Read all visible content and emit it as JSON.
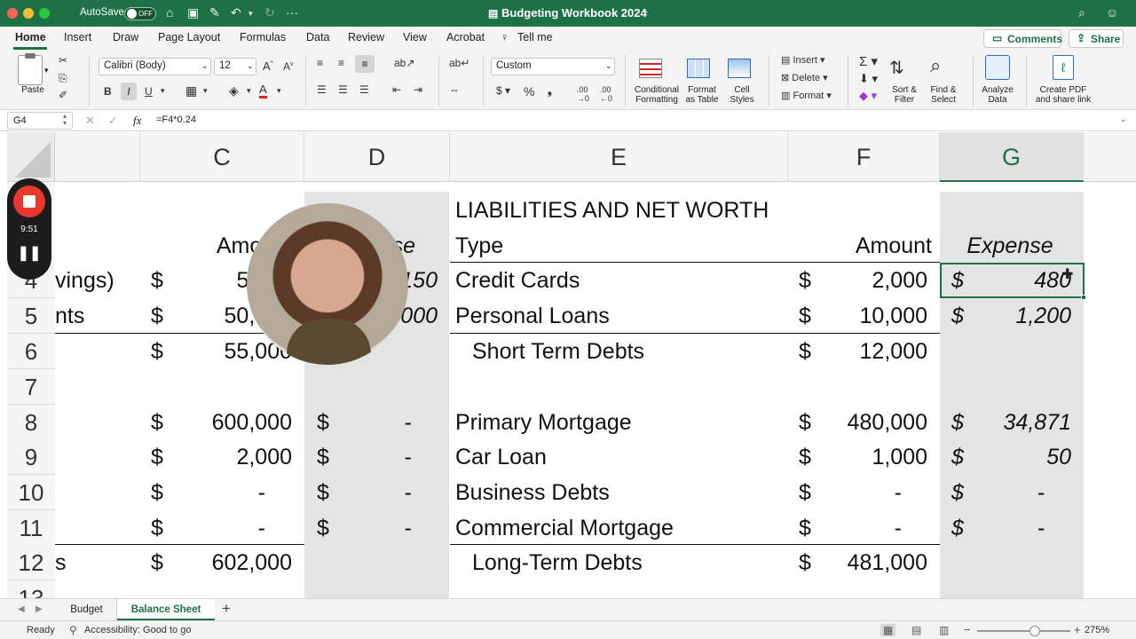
{
  "window": {
    "title": "Budgeting Workbook 2024",
    "autosave_label": "AutoSave",
    "autosave_state": "OFF"
  },
  "tabs": [
    "Home",
    "Insert",
    "Draw",
    "Page Layout",
    "Formulas",
    "Data",
    "Review",
    "View",
    "Acrobat",
    "Tell me"
  ],
  "active_tab": "Home",
  "share": {
    "comments_label": "Comments",
    "share_label": "Share"
  },
  "ribbon": {
    "paste_label": "Paste",
    "font_name": "Calibri (Body)",
    "font_size": "12",
    "number_format": "Custom",
    "conditional_formatting": [
      "Conditional",
      "Formatting"
    ],
    "format_as_table": [
      "Format",
      "as Table"
    ],
    "cell_styles": [
      "Cell",
      "Styles"
    ],
    "insert_label": "Insert",
    "delete_label": "Delete",
    "format_label": "Format",
    "sort_filter": [
      "Sort &",
      "Filter"
    ],
    "find_select": [
      "Find &",
      "Select"
    ],
    "analyze_data": [
      "Analyze",
      "Data"
    ],
    "create_pdf": [
      "Create PDF",
      "and share link"
    ]
  },
  "formula_bar": {
    "name_box": "G4",
    "fx": "fx",
    "formula": "=F4*0.24"
  },
  "columns": [
    "C",
    "D",
    "E",
    "F",
    "G"
  ],
  "rows": [
    "4",
    "5",
    "6",
    "7",
    "8",
    "9",
    "10",
    "11",
    "12",
    "13"
  ],
  "cells": {
    "c_header": "Amount",
    "d_header": "Expense",
    "e_title": "LIABILITIES AND NET WORTH",
    "e_type": "Type",
    "f_header": "Amount",
    "g_header": "Expense",
    "b4": "vings)",
    "b5": "nts",
    "b12": "s",
    "dollar": "$",
    "c4": "5,000",
    "c5": "50,000",
    "c6": "55,000",
    "c8": "600,000",
    "c9": "2,000",
    "c10": "-",
    "c11": "-",
    "c12": "602,000",
    "d4": "150",
    "d5": "3,000",
    "d8": "-",
    "d9": "-",
    "d10": "-",
    "d11": "-",
    "e4": "Credit Cards",
    "e5": "Personal Loans",
    "e6": "Short Term Debts",
    "e8": "Primary Mortgage",
    "e9": "Car Loan",
    "e10": "Business Debts",
    "e11": "Commercial Mortgage",
    "e12": "Long-Term Debts",
    "f4": "2,000",
    "f5": "10,000",
    "f6": "12,000",
    "f8": "480,000",
    "f9": "1,000",
    "f10": "-",
    "f11": "-",
    "f12": "481,000",
    "g4": "480",
    "g5": "1,200",
    "g8": "34,871",
    "g9": "50",
    "g10": "-",
    "g11": "-"
  },
  "recording": {
    "time": "9:51"
  },
  "sheet_tabs": [
    "Budget",
    "Balance Sheet"
  ],
  "active_sheet": "Balance Sheet",
  "status": {
    "ready": "Ready",
    "accessibility": "Accessibility: Good to go",
    "zoom": "275%",
    "zoom_level": 0.62
  },
  "colors": {
    "excel_green": "#1e7145",
    "shade": "#e4e4e4",
    "record_red": "#e8372c"
  }
}
